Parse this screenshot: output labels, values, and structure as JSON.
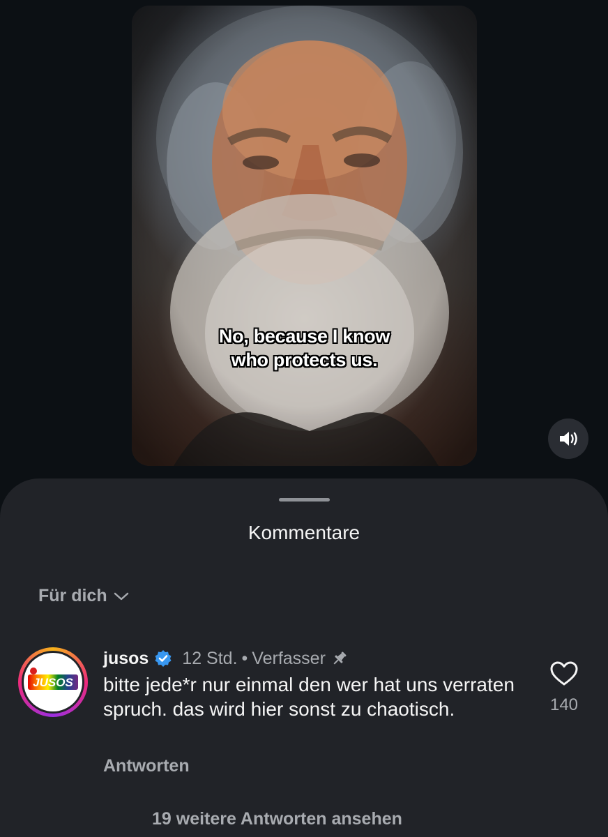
{
  "video": {
    "caption_line1": "No, because I know",
    "caption_line2": "who protects us."
  },
  "controls": {
    "volume_icon": "speaker-on-icon"
  },
  "comments_sheet": {
    "title": "Kommentare",
    "sort_label": "Für dich",
    "comment": {
      "username": "jusos",
      "avatar_text": "JUSOS",
      "time": "12 Std.",
      "separator": "•",
      "author_tag": "Verfasser",
      "text": "bitte jede*r nur einmal den wer hat uns verraten spruch. das wird hier sonst zu chaotisch.",
      "reply_label": "Antworten",
      "like_count": "140"
    },
    "more_replies_label": "19 weitere Antworten ansehen"
  },
  "colors": {
    "background": "#0c1014",
    "sheet": "#212328",
    "secondary_text": "#a8abb0",
    "verified_blue": "#3897f0"
  }
}
